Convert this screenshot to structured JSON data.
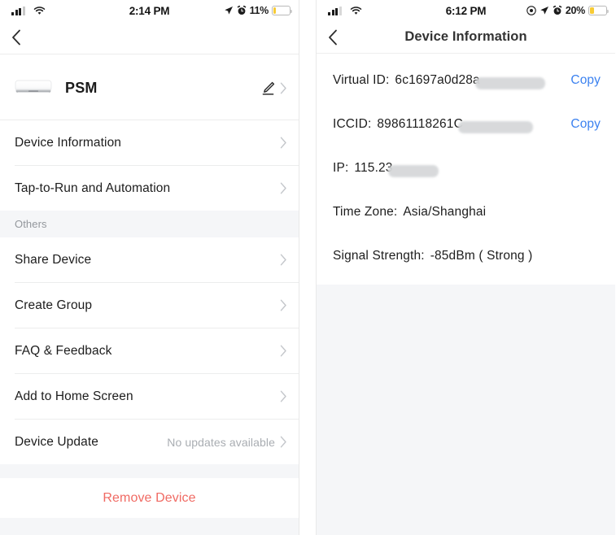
{
  "screens": {
    "left": {
      "status_bar": {
        "time": "2:14 PM",
        "battery_pct": "11%",
        "icons": [
          "signal-bars-icon",
          "wifi-icon",
          "location-arrow-icon",
          "alarm-clock-icon",
          "battery-icon"
        ]
      },
      "nav": {
        "back_icon": "chevron-left-icon"
      },
      "device": {
        "name": "PSM",
        "thumb_icon": "air-conditioner-icon",
        "edit_icon": "pencil-icon",
        "chevron_icon": "chevron-right-icon"
      },
      "menu": [
        {
          "label": "Device Information",
          "value": ""
        },
        {
          "label": "Tap-to-Run and Automation",
          "value": ""
        }
      ],
      "others_header": "Others",
      "others": [
        {
          "label": "Share Device",
          "value": ""
        },
        {
          "label": "Create Group",
          "value": ""
        },
        {
          "label": "FAQ & Feedback",
          "value": ""
        },
        {
          "label": "Add to Home Screen",
          "value": ""
        },
        {
          "label": "Device Update",
          "value": "No updates available"
        }
      ],
      "remove_label": "Remove Device"
    },
    "right": {
      "status_bar": {
        "time": "6:12 PM",
        "battery_pct": "20%",
        "icons": [
          "signal-bars-icon",
          "wifi-icon",
          "focus-target-icon",
          "location-arrow-icon",
          "alarm-clock-icon",
          "battery-icon"
        ]
      },
      "nav": {
        "back_icon": "chevron-left-icon",
        "title": "Device Information"
      },
      "info": [
        {
          "key": "Virtual ID:",
          "value": "6c1697a0d28a",
          "redacted": true,
          "copy": "Copy"
        },
        {
          "key": "ICCID:",
          "value": "89861118261C",
          "redacted": true,
          "copy": "Copy"
        },
        {
          "key": "IP:",
          "value": "115.23",
          "redacted": true,
          "copy": ""
        },
        {
          "key": "Time Zone:",
          "value": "Asia/Shanghai",
          "redacted": false,
          "copy": ""
        },
        {
          "key": "Signal Strength:",
          "value": "-85dBm ( Strong )",
          "redacted": false,
          "copy": ""
        }
      ]
    }
  },
  "colors": {
    "link_blue": "#3c82f0",
    "danger_red": "#f06a63",
    "battery_yellow": "#f7cb35",
    "page_grey": "#f5f6f8"
  }
}
